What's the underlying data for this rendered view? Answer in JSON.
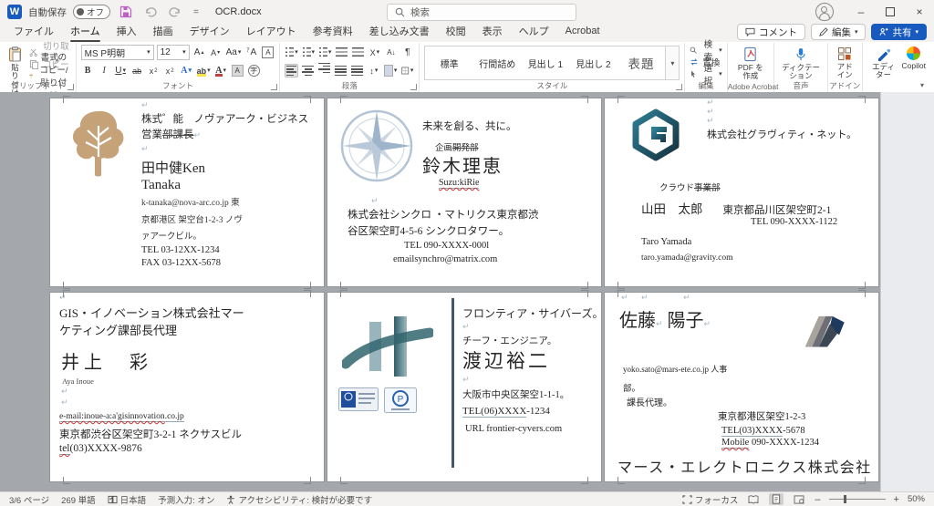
{
  "icons": {
    "chevron": "▾",
    "pilcrow": "↵",
    "more": "▾",
    "minimize": "–",
    "close": "×",
    "equals": "="
  },
  "titlebar": {
    "autosave_label": "自動保存",
    "autosave_state": "オフ",
    "doc_title": "OCR.docx",
    "search_label": "検索"
  },
  "actions": {
    "comments": "コメント",
    "editing": "編集",
    "share": "共有"
  },
  "tabs": [
    "ファイル",
    "ホーム",
    "挿入",
    "描画",
    "デザイン",
    "レイアウト",
    "参考資料",
    "差し込み文書",
    "校閲",
    "表示",
    "ヘルプ",
    "Acrobat"
  ],
  "ribbon": {
    "paste": "貼り付け",
    "cut": "切り取り",
    "copy": "コピー",
    "format_painter": "書式のコピー/貼り付け",
    "group_clipboard": "クリップボード",
    "font_name": "MS P明朝",
    "font_size": "12",
    "group_font": "フォント",
    "group_paragraph": "段落",
    "styles": [
      "標準",
      "行間詰め",
      "見出し 1",
      "見出し 2",
      "表題"
    ],
    "group_styles": "スタイル",
    "find": "検索",
    "replace": "置換",
    "select": "選択",
    "group_editing": "編集",
    "create_pdf": "PDF を作成",
    "group_acrobat": "Adobe Acrobat",
    "dictation": "ディクテーション",
    "group_voice": "音声",
    "addins": "アドイン",
    "group_addins": "アドイン",
    "editor": "エディター",
    "copilot": "Copilot"
  },
  "cards": {
    "card1": {
      "company_line1": "株式゜能　ノヴァアーク・ビジネス",
      "company_line2_pre": "営業",
      "company_line2_strike": "部課長",
      "person": "田中健Ken",
      "person2": "Tanaka",
      "contact1": "k-tanaka@nova-arc.co.jp 東",
      "contact2": "京都港区 架空台1-2-3 ノヴ",
      "contact3": "ァアークビル。",
      "tel": "TEL 03-12XX-1234",
      "fax": "FAX 03-12XX-5678"
    },
    "card2": {
      "slogan": "未来を創る、共に。",
      "dept_pre": "企画",
      "dept_strike": "開発部",
      "person": "鈴木理恵",
      "romaji": "Suzu:kiRie",
      "company1": "株式会社シンクロ ・マトリクス東京都渋",
      "company2": "谷区架空町4-5-6 シンクロタワー。",
      "tel": "TEL 090-XXXX-000l",
      "email": "emailsynchro@matrix.com"
    },
    "card3": {
      "company": "株式会社グラヴィティ・ネット。",
      "dept_pre": "クラウド",
      "dept_strike": "事業部",
      "person": "山田　太郎",
      "address": "東京都品川区架空町2-1",
      "tel": "TEL 090-XXXX-1122",
      "romaji": "Taro Yamada",
      "email": "taro.yamada@gravity.com"
    },
    "card4": {
      "company_line1": "GIS・イノベーション株式会社マー",
      "company_line2": "ケティング課部長代理",
      "person": "井上　彩",
      "romaji": "Aya Inoue",
      "email_a": "e-mail:inoue-a:a'gisinnovation",
      "email_b": ".co.jp",
      "address": "東京都渋谷区架空町3-2-1  ネクサスビル",
      "tel_word": "tel",
      "tel_rest": "(03)XXXX-9876"
    },
    "card5": {
      "company": "フロンティア・サイバーズ。",
      "title": "チーフ・エンジニア。",
      "person": "渡辺裕二",
      "address": "大阪市中央区架空1-1-1。",
      "tel_underlined": "TEL(06)XXXX",
      "tel_rest": "-1234",
      "url": "URL frontier-cyvers.com"
    },
    "card6": {
      "person_family": "佐藤",
      "person_given": "陽子",
      "email_dept": "yoko.sato@mars-ete.co.jp 人事",
      "dept2": "部。",
      "title": "課長代理。",
      "address": "東京都港区架空1-2-3",
      "tel_underlined": "TEL(03)XXXX",
      "tel_rest": "-5678",
      "mobile_word": "Mobile",
      "mobile_rest": "090-XXXX-1234",
      "company": "マース・エレクトロニクス株式会社"
    }
  },
  "statusbar": {
    "page": "3/6 ページ",
    "words": "269 単語",
    "language": "日本語",
    "prediction": "予測入力: オン",
    "accessibility": "アクセシビリティ: 検討が必要です",
    "focus": "フォーカス",
    "zoom": "50%"
  }
}
